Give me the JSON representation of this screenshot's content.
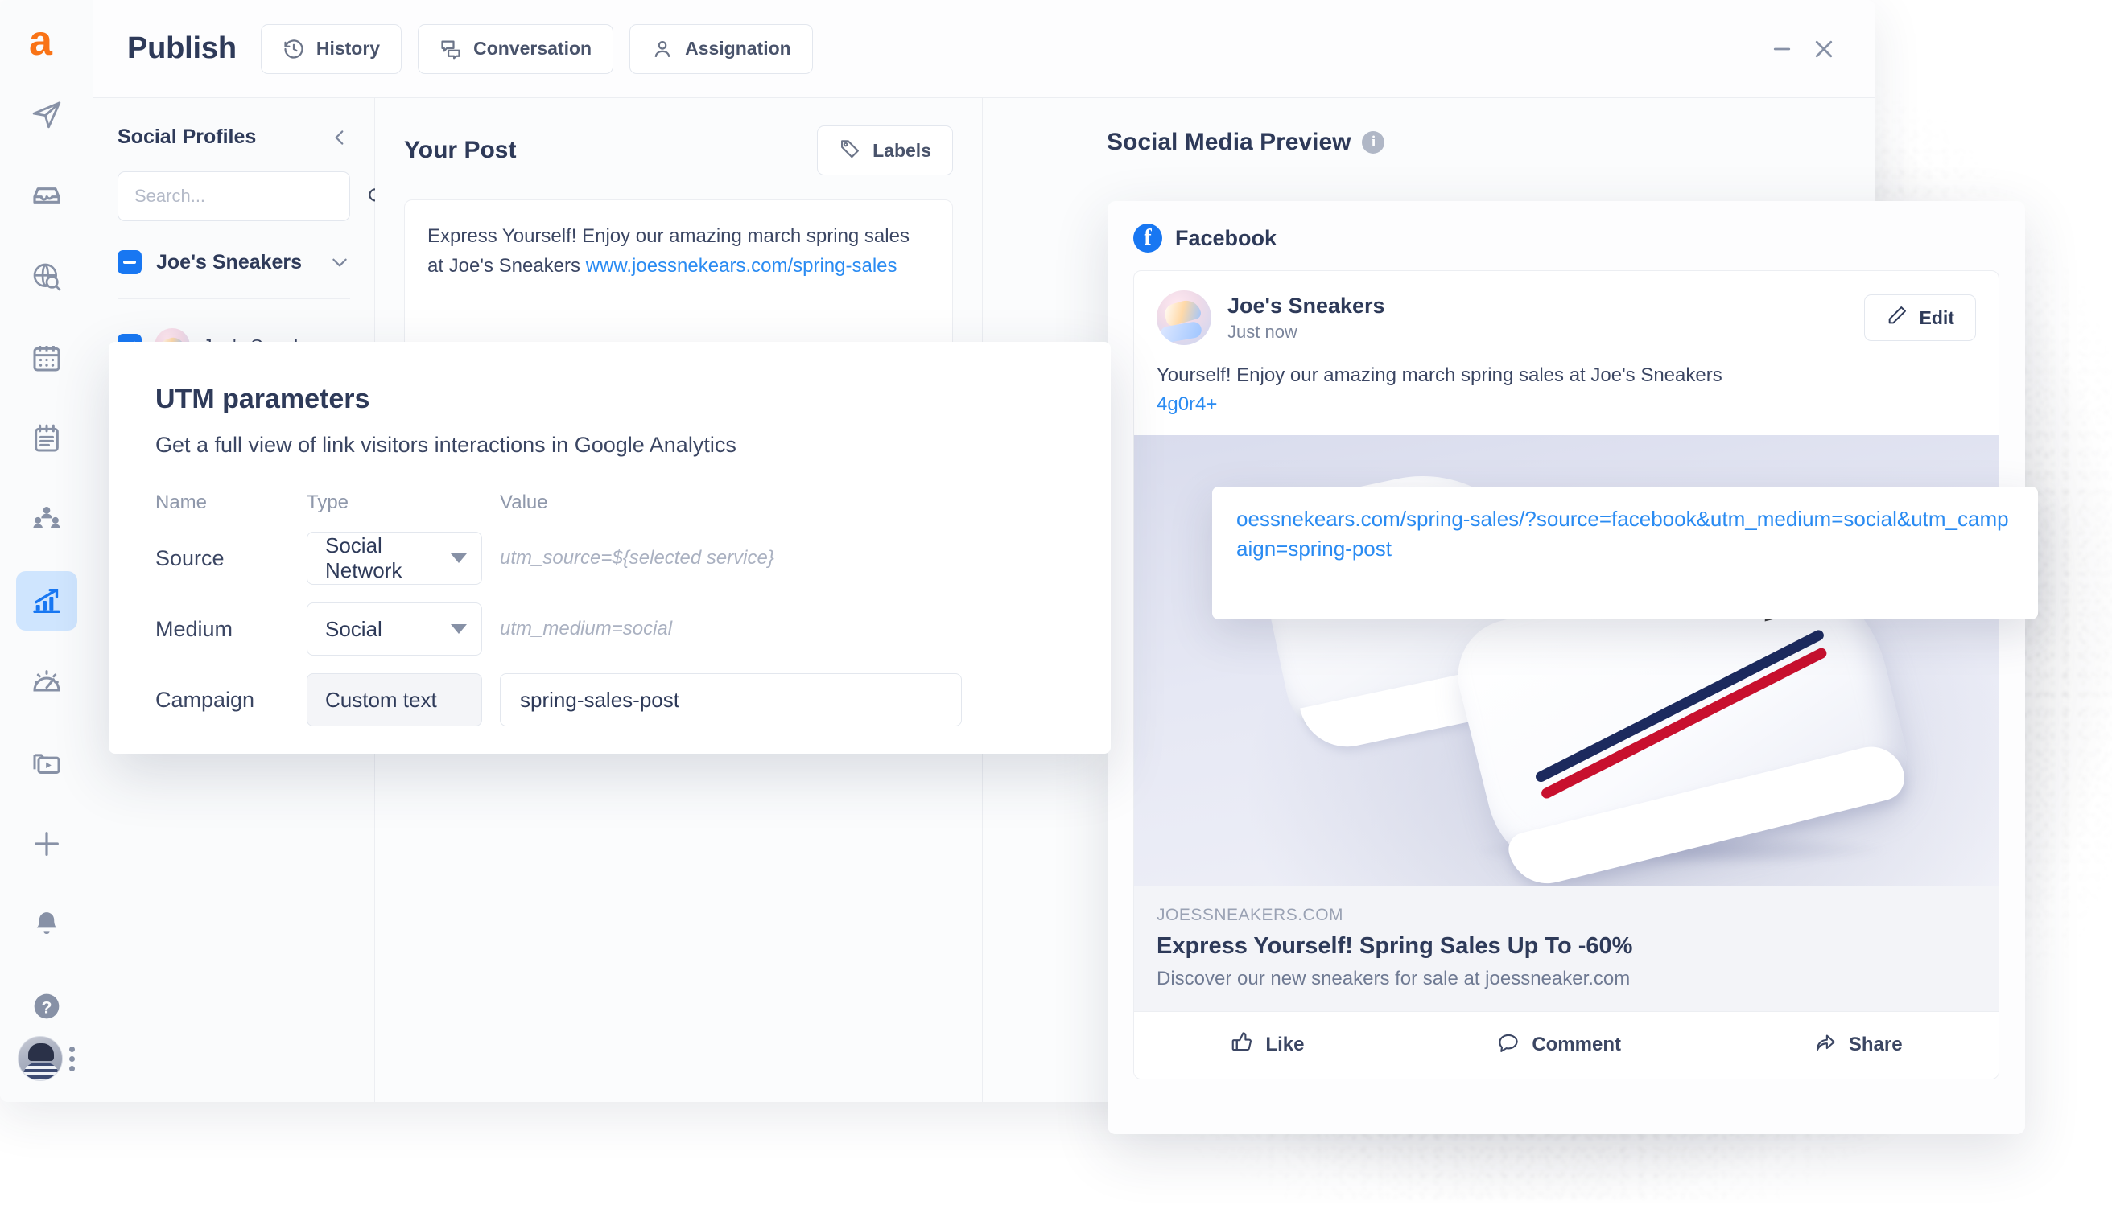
{
  "header": {
    "app_title": "Publish",
    "buttons": [
      {
        "label": "History",
        "icon": "history-icon"
      },
      {
        "label": "Conversation",
        "icon": "conversation-icon"
      },
      {
        "label": "Assignation",
        "icon": "user-icon"
      }
    ],
    "window_controls": {
      "minimize": "minimize-icon",
      "close": "close-icon"
    }
  },
  "rail": {
    "logo": "a",
    "items": [
      {
        "name": "send-icon",
        "active": false
      },
      {
        "name": "inbox-icon",
        "active": false
      },
      {
        "name": "globe-search-icon",
        "active": false
      },
      {
        "name": "calendar-icon",
        "active": false
      },
      {
        "name": "notepad-icon",
        "active": false
      },
      {
        "name": "team-icon",
        "active": false
      },
      {
        "name": "analytics-icon",
        "active": true
      },
      {
        "name": "speedometer-icon",
        "active": false
      },
      {
        "name": "media-folder-icon",
        "active": false
      },
      {
        "name": "plus-icon",
        "active": false
      },
      {
        "name": "bell-icon",
        "active": false
      },
      {
        "name": "help-icon",
        "active": false
      }
    ]
  },
  "profiles": {
    "title": "Social Profiles",
    "collapse_icon": "chevron-left-icon",
    "search_placeholder": "Search...",
    "search_value": "",
    "search_icon": "search-icon",
    "group": {
      "name": "Joe's Sneakers",
      "checkbox_state": "indeterminate",
      "chevron": "chevron-down-icon"
    },
    "accounts": [
      {
        "name": "Joe's Sneakers",
        "network": "facebook",
        "checked": true
      }
    ]
  },
  "post": {
    "title": "Your Post",
    "labels_button": "Labels",
    "labels_icon": "tag-icon",
    "text_plain": "Express Yourself! Enjoy our amazing march spring sales at Joe's Sneakers ",
    "text_link": "www.joessnekears.com/spring-sales"
  },
  "preview": {
    "title": "Social Media Preview",
    "info_icon": "info-icon",
    "network": "Facebook",
    "network_icon": "facebook-icon",
    "account_name": "Joe's Sneakers",
    "timestamp": "Just now",
    "edit_button": "Edit",
    "edit_icon": "pencil-icon",
    "body_text": "Yourself! Enjoy our amazing march spring sales at Joe's Sneakers",
    "body_link": "4g0r4+",
    "link_meta": {
      "domain": "JOESSNEAKERS.COM",
      "title": "Express Yourself! Spring Sales Up To -60%",
      "description": "Discover our new sneakers for sale at joessneaker.com"
    },
    "actions": [
      {
        "label": "Like",
        "icon": "thumbs-up-icon"
      },
      {
        "label": "Comment",
        "icon": "comment-icon"
      },
      {
        "label": "Share",
        "icon": "share-icon"
      }
    ]
  },
  "url_popup": {
    "text": "oessnekears.com/spring-sales/?source=facebook&utm_medium=social&utm_campaign=spring-post"
  },
  "utm": {
    "title": "UTM parameters",
    "subtitle": "Get a full view of link visitors interactions in Google Analytics",
    "columns": {
      "name": "Name",
      "type": "Type",
      "value": "Value"
    },
    "rows": [
      {
        "name": "Source",
        "type": "Social Network",
        "type_kind": "select",
        "value": "utm_source=${selected service}",
        "value_kind": "hint"
      },
      {
        "name": "Medium",
        "type": "Social",
        "type_kind": "select",
        "value": "utm_medium=social",
        "value_kind": "hint"
      },
      {
        "name": "Campaign",
        "type": "Custom text",
        "type_kind": "static",
        "value": "spring-sales-post",
        "value_kind": "input"
      }
    ]
  },
  "colors": {
    "brand_orange": "#F97316",
    "accent_blue": "#1877F2",
    "link_blue": "#2A8BF2",
    "text_dark": "#2E3A59",
    "text_muted": "#7C869C"
  }
}
